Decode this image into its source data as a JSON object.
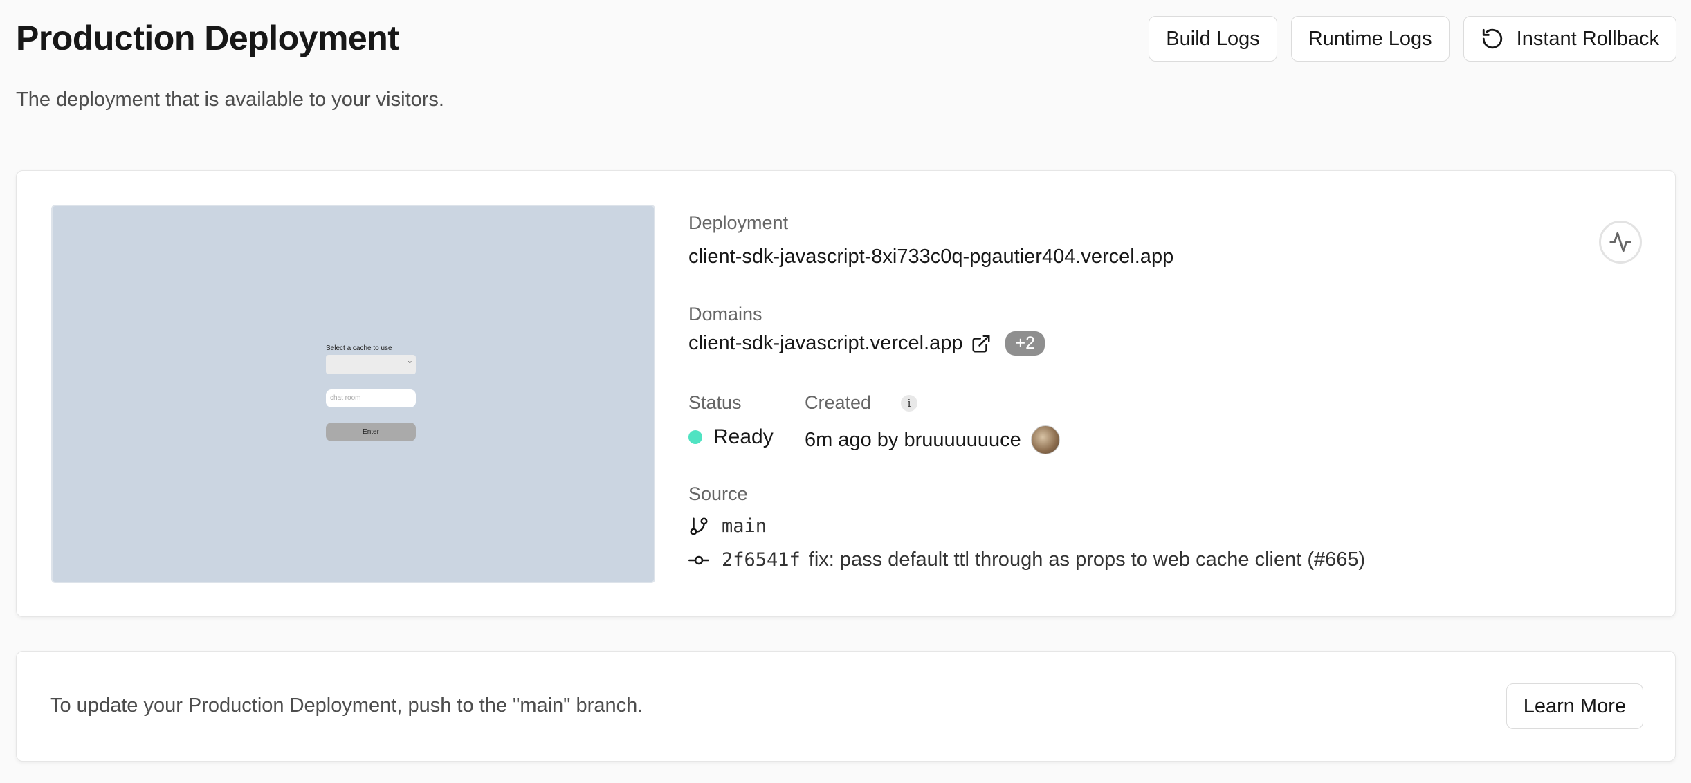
{
  "header": {
    "title": "Production Deployment",
    "subtitle": "The deployment that is available to your visitors.",
    "build_logs_label": "Build Logs",
    "runtime_logs_label": "Runtime Logs",
    "rollback_label": "Instant Rollback"
  },
  "preview": {
    "select_label": "Select a cache to use",
    "input_placeholder": "chat room",
    "enter_label": "Enter"
  },
  "deployment": {
    "label": "Deployment",
    "url": "client-sdk-javascript-8xi733c0q-pgautier404.vercel.app"
  },
  "domains": {
    "label": "Domains",
    "primary": "client-sdk-javascript.vercel.app",
    "extra_count": "+2"
  },
  "status": {
    "label": "Status",
    "value": "Ready",
    "color": "#50e3c2"
  },
  "created": {
    "label": "Created",
    "info_icon": "i",
    "value": "6m ago by bruuuuuuuce"
  },
  "source": {
    "label": "Source",
    "branch": "main",
    "commit_hash": "2f6541f",
    "commit_message": "fix: pass default ttl through as props to web cache client (#665)"
  },
  "footer": {
    "text": "To update your Production Deployment, push to the \"main\" branch.",
    "learn_more_label": "Learn More"
  }
}
